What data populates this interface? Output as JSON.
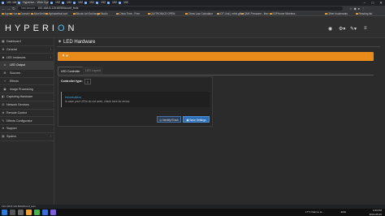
{
  "browser": {
    "tabs": [
      {
        "title": "192.168.8.119",
        "active": false
      },
      {
        "title": "Hyperion - Web Configuration",
        "active": true
      },
      {
        "title": "192.168.8.119",
        "active": false
      },
      {
        "title": "192.168.8.119",
        "active": false
      },
      {
        "title": "192.168.8.119",
        "active": false
      },
      {
        "title": "192.168.8.119",
        "active": false
      },
      {
        "title": "192.168.8.119",
        "active": false
      },
      {
        "title": "192.168.8.119",
        "active": false
      },
      {
        "title": "192.168.8.119",
        "active": false
      }
    ],
    "security_label": "Not secure",
    "url": "192.168.8.119:8090/#conf_leds",
    "bookmarks": [
      "Apps",
      "Hue",
      "Domain",
      "AliceSmith",
      "Alphabetical sort",
      "Bitcoin Art Exchange",
      "Studio",
      "China Time - Free",
      "QUITRONICS OPEN",
      "Ohms Law Calculator",
      "IOT Link | nrfnk.gith",
      "QMK Firmware - thec",
      "ESPHome Wireless",
      "Other bookmarks",
      "Reading list"
    ]
  },
  "header": {
    "logo_text": "HYPERI",
    "logo_o": "O",
    "logo_end": "N"
  },
  "sidebar": {
    "items": [
      {
        "label": "Dashboard",
        "icon": "dashboard-icon",
        "sub": false,
        "active": false,
        "chevron": false
      },
      {
        "label": "General",
        "icon": "gear-icon",
        "sub": false,
        "active": false,
        "chevron": true
      },
      {
        "label": "LED Instances",
        "icon": "lightbulb-icon",
        "sub": false,
        "active": false,
        "chevron": true
      },
      {
        "label": "LED Output",
        "icon": "led-icon",
        "sub": true,
        "active": true,
        "chevron": false
      },
      {
        "label": "Sources",
        "icon": "sources-icon",
        "sub": true,
        "active": false,
        "chevron": false
      },
      {
        "label": "Effects",
        "icon": "effects-icon",
        "sub": true,
        "active": false,
        "chevron": false
      },
      {
        "label": "Image Processing",
        "icon": "image-icon",
        "sub": true,
        "active": false,
        "chevron": false
      },
      {
        "label": "Capturing Hardware",
        "icon": "camera-icon",
        "sub": false,
        "active": false,
        "chevron": false
      },
      {
        "label": "Network Services",
        "icon": "network-icon",
        "sub": false,
        "active": false,
        "chevron": false
      },
      {
        "label": "Remote Control",
        "icon": "remote-icon",
        "sub": false,
        "active": false,
        "chevron": false
      },
      {
        "label": "Effects Configurator",
        "icon": "magic-icon",
        "sub": false,
        "active": false,
        "chevron": false
      },
      {
        "label": "Support",
        "icon": "heart-icon",
        "sub": false,
        "active": false,
        "chevron": false
      },
      {
        "label": "System",
        "icon": "system-icon",
        "sub": false,
        "active": false,
        "chevron": true
      }
    ]
  },
  "main": {
    "title": "LED Hardware",
    "instance_selector": "▾",
    "tabs": [
      {
        "label": "LED Controller",
        "active": true
      },
      {
        "label": "LED Layout",
        "active": false
      }
    ],
    "controller_label": "Controller type:",
    "controller_value": "‡",
    "info_title": "Information",
    "info_text": "In case your LEDs do not work, check here for errors.",
    "identify_button": "Identify/Track",
    "save_button": "Save Settings"
  },
  "status_url": "192.168.8.119:8090/#conf_leds",
  "tray": {
    "weather": "17°C  Rain to st...",
    "lang": "ENG",
    "time": "3:43 PM",
    "date": "2022-05-20"
  },
  "colors": {
    "accent_orange": "#e88b1b",
    "info_blue": "#4aa3df",
    "save_blue": "#2d6fb8",
    "logo_blue": "#59b8e6"
  }
}
